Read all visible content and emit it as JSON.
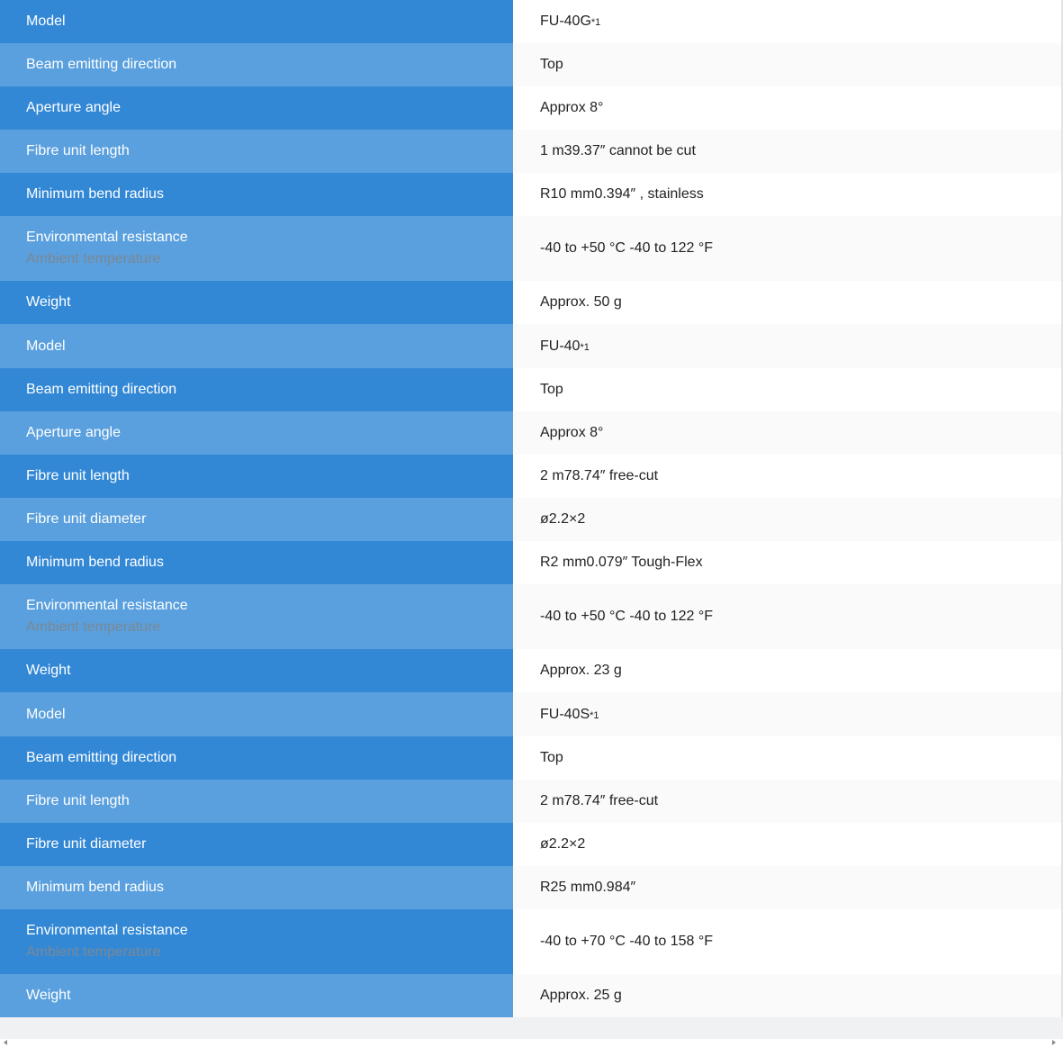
{
  "groups": [
    {
      "rows": [
        {
          "label": "Model",
          "value": "FU-40G",
          "sup": "*1"
        },
        {
          "label": "Beam emitting direction",
          "value": "Top"
        },
        {
          "label": "Aperture angle",
          "value": "Approx 8°"
        },
        {
          "label": "Fibre unit length",
          "value": "1 m39.37″ cannot be cut"
        },
        {
          "label": "Minimum bend radius",
          "value": "R10 mm0.394″ , stainless"
        },
        {
          "label": "Environmental resistance",
          "sublabel": "Ambient temperature",
          "value": "-40 to +50 °C -40 to 122 °F"
        },
        {
          "label": "Weight",
          "value": "Approx. 50 g"
        }
      ]
    },
    {
      "rows": [
        {
          "label": "Model",
          "value": "FU-40",
          "sup": "*1"
        },
        {
          "label": "Beam emitting direction",
          "value": "Top"
        },
        {
          "label": "Aperture angle",
          "value": "Approx 8°"
        },
        {
          "label": "Fibre unit length",
          "value": "2 m78.74″ free-cut"
        },
        {
          "label": "Fibre unit diameter",
          "value": "ø2.2×2"
        },
        {
          "label": "Minimum bend radius",
          "value": "R2 mm0.079″ Tough-Flex"
        },
        {
          "label": "Environmental resistance",
          "sublabel": "Ambient temperature",
          "value": "-40 to +50 °C -40 to 122 °F"
        },
        {
          "label": "Weight",
          "value": "Approx. 23 g"
        }
      ]
    },
    {
      "rows": [
        {
          "label": "Model",
          "value": "FU-40S",
          "sup": "*1"
        },
        {
          "label": "Beam emitting direction",
          "value": "Top"
        },
        {
          "label": "Fibre unit length",
          "value": "2 m78.74″ free-cut"
        },
        {
          "label": "Fibre unit diameter",
          "value": "ø2.2×2"
        },
        {
          "label": "Minimum bend radius",
          "value": "R25 mm0.984″"
        },
        {
          "label": "Environmental resistance",
          "sublabel": "Ambient temperature",
          "value": "-40 to +70 °C -40 to 158 °F"
        },
        {
          "label": "Weight",
          "value": "Approx. 25 g"
        }
      ]
    }
  ],
  "colors": {
    "label_dark": "#3388d6",
    "label_light": "#5aa0de",
    "sublabel": "#7a8894",
    "value_text": "#222222"
  },
  "icons": {
    "scroll_left": "scroll-left-arrow-icon",
    "scroll_right": "scroll-right-arrow-icon"
  }
}
